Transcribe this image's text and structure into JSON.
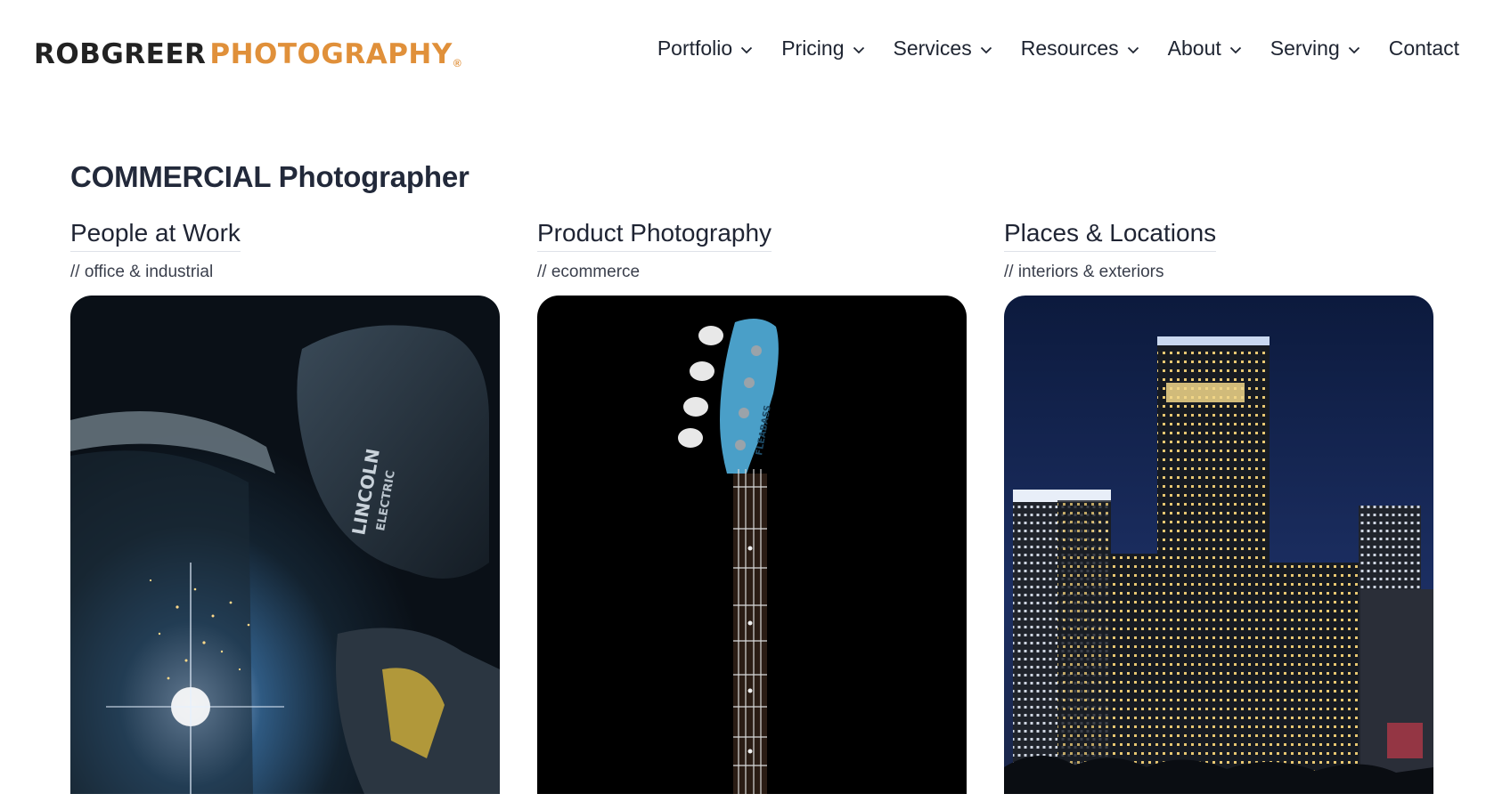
{
  "brand": {
    "left": "ROBGREER",
    "right": "PHOTOGRAPHY",
    "reg": "®"
  },
  "nav": {
    "items": [
      {
        "label": "Portfolio",
        "has_dropdown": true
      },
      {
        "label": "Pricing",
        "has_dropdown": true
      },
      {
        "label": "Services",
        "has_dropdown": true
      },
      {
        "label": "Resources",
        "has_dropdown": true
      },
      {
        "label": "About",
        "has_dropdown": true
      },
      {
        "label": "Serving",
        "has_dropdown": true
      },
      {
        "label": "Contact",
        "has_dropdown": false
      }
    ]
  },
  "section": {
    "title": "COMMERCIAL Photographer"
  },
  "cards": [
    {
      "title": "People at Work",
      "subtitle": "// office & industrial",
      "image": "welder-photo"
    },
    {
      "title": "Product Photography",
      "subtitle": "// ecommerce",
      "image": "bass-guitar-photo"
    },
    {
      "title": "Places & Locations",
      "subtitle": "// interiors & exteriors",
      "image": "city-skyline-photo"
    }
  ],
  "colors": {
    "brand_orange": "#e0903a",
    "text_dark": "#1f2433"
  }
}
